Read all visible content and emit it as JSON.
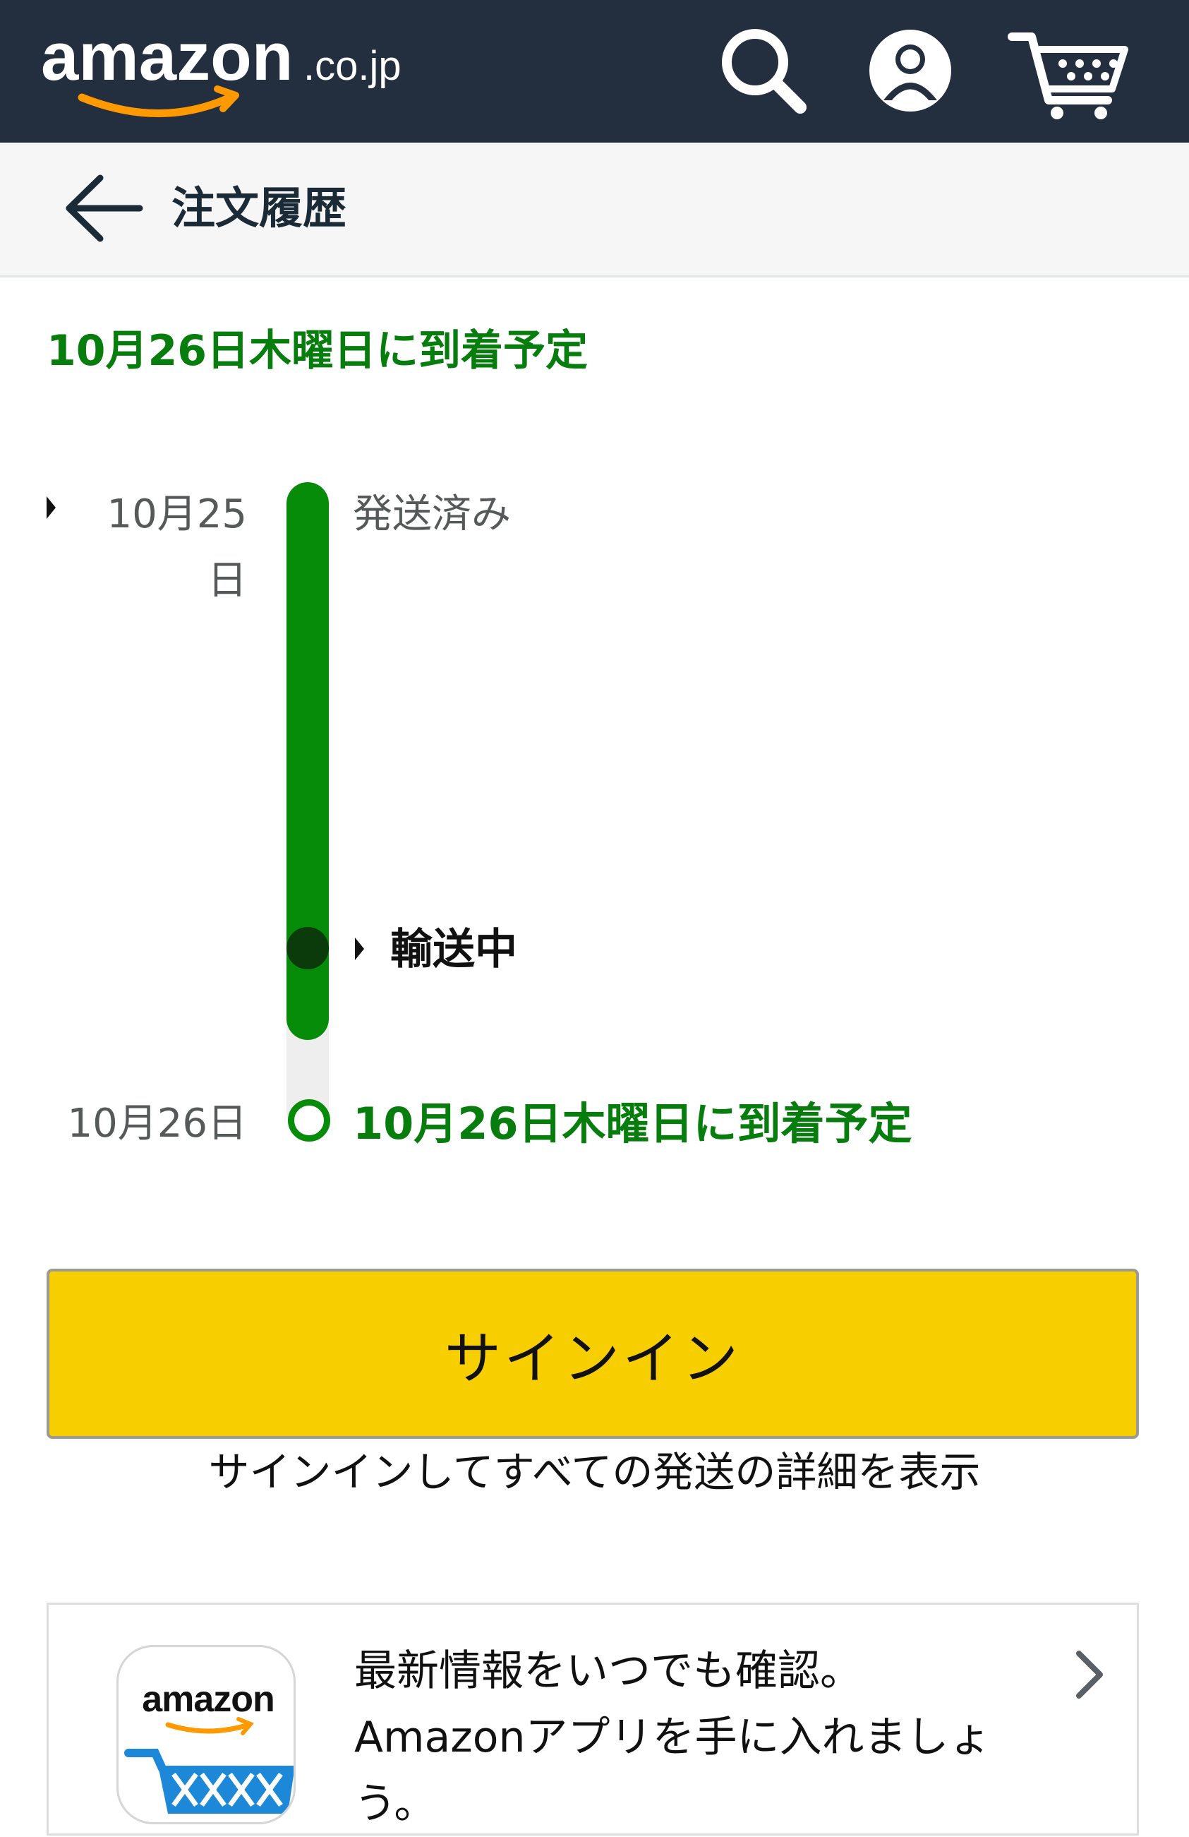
{
  "header": {
    "logo_word": "amazon",
    "logo_suffix": ".co.jp",
    "icons": [
      "search-icon",
      "account-icon",
      "cart-icon"
    ]
  },
  "subheader": {
    "title": "注文履歴"
  },
  "arrival": {
    "title": "10月26日木曜日に到着予定"
  },
  "timeline": [
    {
      "date": "10月25日",
      "status": "発送済み"
    },
    {
      "date": "",
      "status": "輸送中"
    },
    {
      "date": "10月26日",
      "status": "10月26日木曜日に到着予定"
    }
  ],
  "signin": {
    "button_label": "サインイン",
    "note": "サインインしてすべての発送の詳細を表示"
  },
  "promo": {
    "icon_word": "amazon",
    "text": "最新情報をいつでも確認。Amazonアプリを手に入れましょう。"
  },
  "colors": {
    "header_bg": "#232f3e",
    "accent_green": "#067d0c",
    "timeline_green": "#078c0a",
    "button_yellow": "#f7ce00",
    "logo_smile": "#ff9900"
  }
}
